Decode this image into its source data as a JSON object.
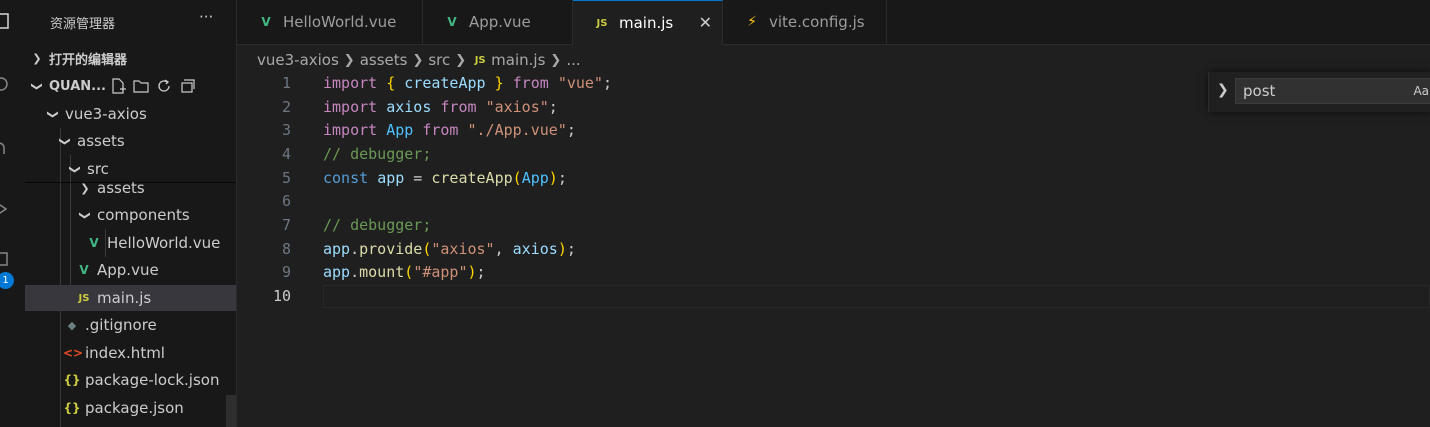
{
  "sidebar": {
    "title": "资源管理器",
    "more": "···",
    "open_editors": "打开的编辑器",
    "workspace": "QUAN...",
    "activity_badge": "1",
    "tree": [
      {
        "label": "vue3-axios",
        "icon": "folder-open"
      },
      {
        "label": "assets",
        "icon": "folder-open"
      },
      {
        "label": "src",
        "icon": "folder-open"
      },
      {
        "label": "assets",
        "icon": "folder-closed"
      },
      {
        "label": "components",
        "icon": "folder-open"
      },
      {
        "label": "HelloWorld.vue",
        "icon": "vue-icon"
      },
      {
        "label": "App.vue",
        "icon": "vue-icon"
      },
      {
        "label": "main.js",
        "icon": "js-icon",
        "selected": true
      },
      {
        "label": ".gitignore",
        "icon": "git-icon"
      },
      {
        "label": "index.html",
        "icon": "html-icon"
      },
      {
        "label": "package-lock.json",
        "icon": "json-icon"
      },
      {
        "label": "package.json",
        "icon": "json-icon"
      }
    ]
  },
  "tabs": [
    {
      "label": "HelloWorld.vue",
      "icon": "vue-icon"
    },
    {
      "label": "App.vue",
      "icon": "vue-icon"
    },
    {
      "label": "main.js",
      "icon": "js-icon",
      "active": true
    },
    {
      "label": "vite.config.js",
      "icon": "vite-icon"
    }
  ],
  "breadcrumb": [
    "vue3-axios",
    "assets",
    "src",
    "main.js",
    "..."
  ],
  "editor": {
    "line_numbers": [
      "1",
      "2",
      "3",
      "4",
      "5",
      "6",
      "7",
      "8",
      "9",
      "10"
    ],
    "lines": [
      "import { createApp } from \"vue\";",
      "import axios from \"axios\";",
      "import App from \"./App.vue\";",
      "// debugger;",
      "const app = createApp(App);",
      "",
      "// debugger;",
      "app.provide(\"axios\", axios);",
      "app.mount(\"#app\");",
      ""
    ],
    "current_line": "10"
  },
  "find": {
    "query": "post",
    "match_case_label": "Aa"
  },
  "colors": {
    "accent": "#0078d4",
    "vue": "#41b883",
    "js": "#cbcb41",
    "keyword": "#c586c0",
    "string": "#ce9178",
    "comment": "#6a9955"
  }
}
